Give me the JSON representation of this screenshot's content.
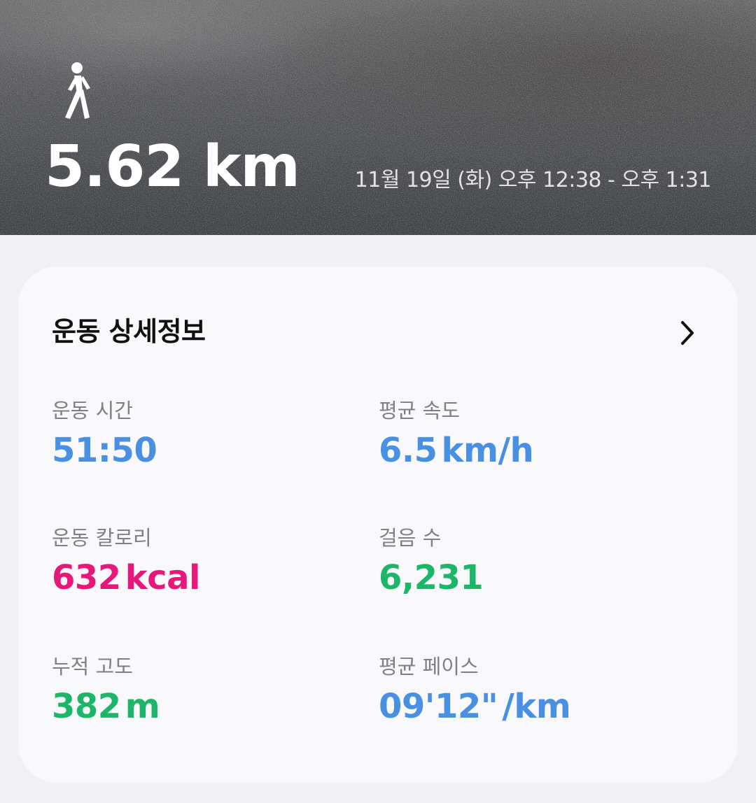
{
  "header": {
    "activity_icon": "walk-icon",
    "distance": "5.62 km",
    "date_range": "11월 19일 (화) 오후 12:38 - 오후 1:31"
  },
  "details": {
    "title": "운동 상세정보",
    "chevron_icon": "chevron-right-icon",
    "stats": [
      {
        "label": "운동 시간",
        "value": "51:50",
        "unit": "",
        "color": "#4a90e2"
      },
      {
        "label": "평균 속도",
        "value": "6.5",
        "unit": "km/h",
        "color": "#4a90e2"
      },
      {
        "label": "운동 칼로리",
        "value": "632",
        "unit": "kcal",
        "color": "#e6197a"
      },
      {
        "label": "걸음 수",
        "value": "6,231",
        "unit": "",
        "color": "#1db567"
      },
      {
        "label": "누적 고도",
        "value": "382",
        "unit": "m",
        "color": "#1db567"
      },
      {
        "label": "평균 페이스",
        "value": "09'12\"",
        "unit": "/km",
        "color": "#4a90e2"
      }
    ]
  },
  "colors": {
    "blue": "#4a90e2",
    "pink": "#e6197a",
    "green": "#1db567",
    "background": "#f1f1f3",
    "card": "#f9f9fc"
  }
}
